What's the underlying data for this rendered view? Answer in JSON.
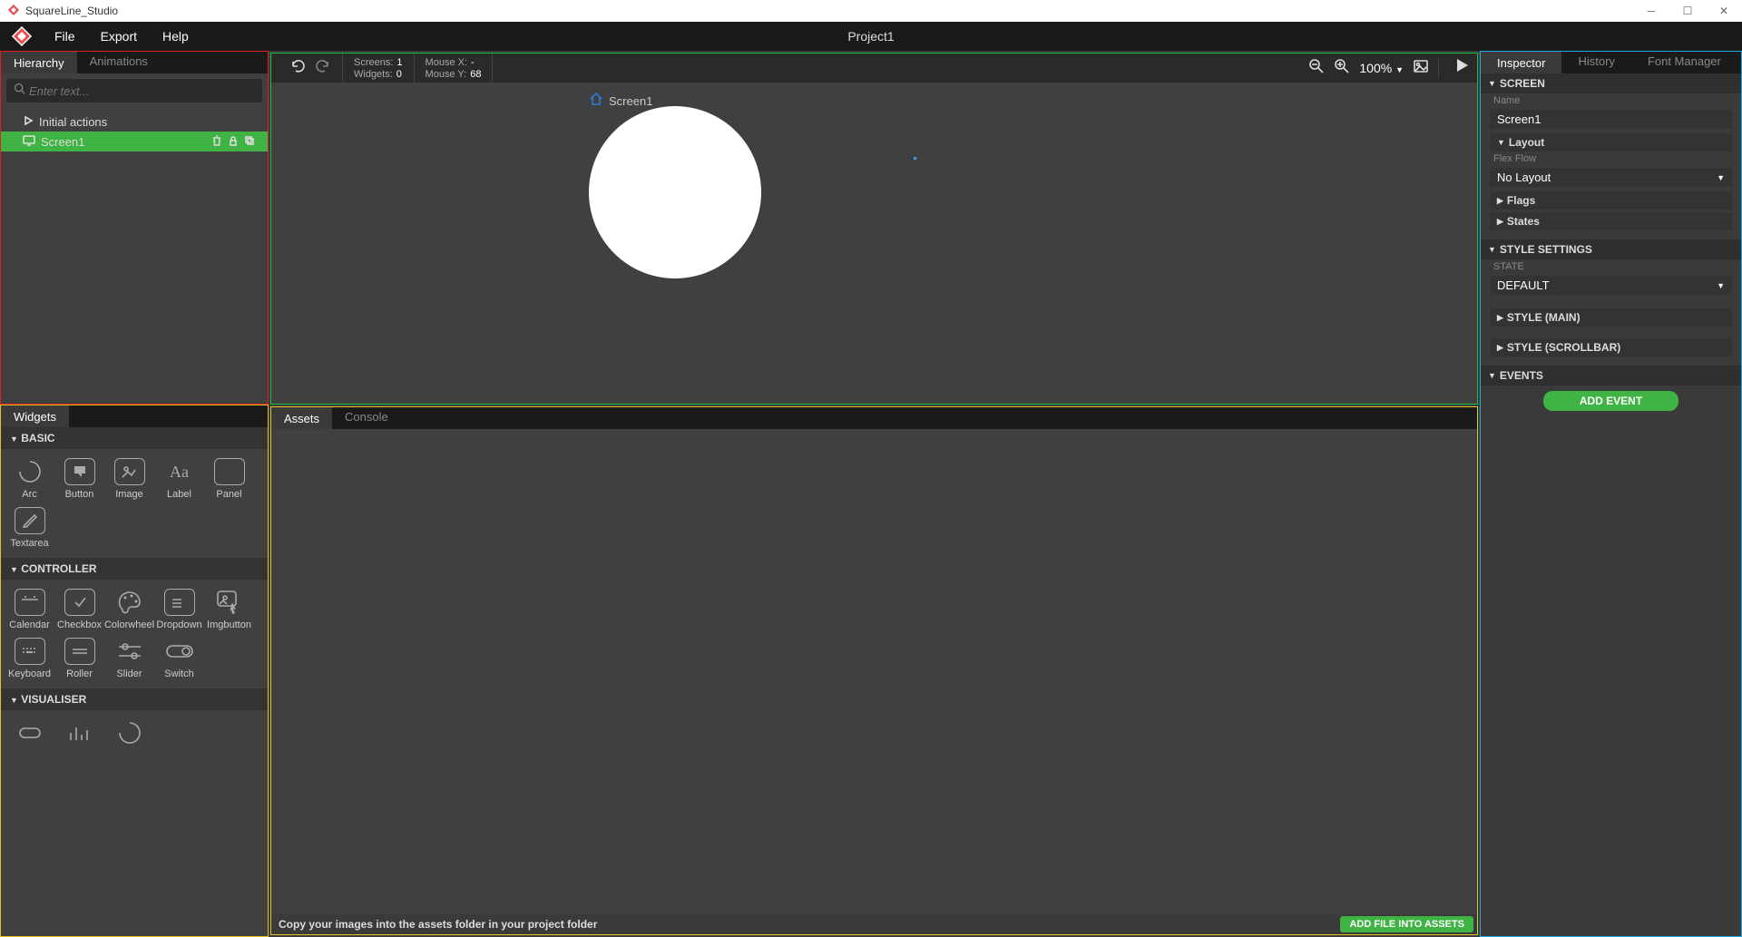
{
  "app": {
    "title": "SquareLine_Studio"
  },
  "menubar": {
    "items": [
      "File",
      "Export",
      "Help"
    ],
    "project": "Project1"
  },
  "hierarchy": {
    "tabs": [
      "Hierarchy",
      "Animations"
    ],
    "search_placeholder": "Enter text...",
    "rows": [
      {
        "label": "Initial actions"
      },
      {
        "label": "Screen1"
      }
    ]
  },
  "widgets": {
    "tab": "Widgets",
    "cats": {
      "basic_title": "BASIC",
      "basic": [
        "Arc",
        "Button",
        "Image",
        "Label",
        "Panel",
        "Textarea"
      ],
      "controller_title": "CONTROLLER",
      "controller": [
        "Calendar",
        "Checkbox",
        "Colorwheel",
        "Dropdown",
        "Imgbutton",
        "Keyboard",
        "Roller",
        "Slider",
        "Switch"
      ],
      "visualiser_title": "VISUALISER"
    }
  },
  "canvas": {
    "screens_label": "Screens:",
    "screens_val": "1",
    "widgets_label": "Widgets:",
    "widgets_val": "0",
    "mousex_label": "Mouse X:",
    "mousex_val": "-",
    "mousey_label": "Mouse Y:",
    "mousey_val": "68",
    "zoom": "100%",
    "screen_name": "Screen1"
  },
  "assets": {
    "tabs": [
      "Assets",
      "Console"
    ],
    "footer": "Copy your images into the assets folder in your project folder",
    "add_btn": "ADD FILE INTO ASSETS"
  },
  "inspector": {
    "tabs": [
      "Inspector",
      "History",
      "Font Manager"
    ],
    "sections": {
      "screen": "SCREEN",
      "name_label": "Name",
      "name_value": "Screen1",
      "layout_label": "Layout",
      "flex_flow_label": "Flex Flow",
      "flex_flow_value": "No Layout",
      "flags_label": "Flags",
      "states_label": "States",
      "style_settings": "STYLE SETTINGS",
      "state_label": "STATE",
      "state_value": "DEFAULT",
      "style_main": "STYLE (MAIN)",
      "style_scrollbar": "STYLE (SCROLLBAR)",
      "events": "EVENTS",
      "add_event": "ADD EVENT"
    }
  }
}
